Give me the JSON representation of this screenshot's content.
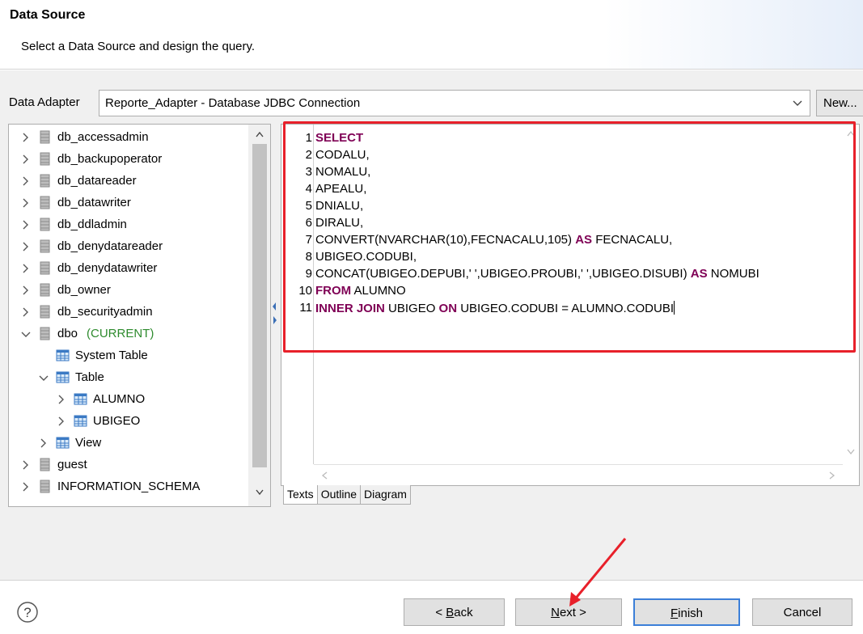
{
  "header": {
    "title": "Data Source",
    "subtitle": "Select a Data Source and design the query."
  },
  "adapter": {
    "label": "Data Adapter",
    "value": "Reporte_Adapter - Database JDBC Connection",
    "new_label": "New..."
  },
  "tree": {
    "items": [
      {
        "label": "db_accessadmin"
      },
      {
        "label": "db_backupoperator"
      },
      {
        "label": "db_datareader"
      },
      {
        "label": "db_datawriter"
      },
      {
        "label": "db_ddladmin"
      },
      {
        "label": "db_denydatareader"
      },
      {
        "label": "db_denydatawriter"
      },
      {
        "label": "db_owner"
      },
      {
        "label": "db_securityadmin"
      },
      {
        "label": "dbo",
        "current": "(CURRENT)"
      },
      {
        "label": "System Table"
      },
      {
        "label": "Table"
      },
      {
        "label": "ALUMNO"
      },
      {
        "label": "UBIGEO"
      },
      {
        "label": "View"
      },
      {
        "label": "guest"
      },
      {
        "label": "INFORMATION_SCHEMA"
      }
    ]
  },
  "editor": {
    "lines": [
      {
        "n": "1",
        "parts": [
          [
            "kw",
            "SELECT"
          ]
        ]
      },
      {
        "n": "2",
        "parts": [
          [
            "t",
            "CODALU,"
          ]
        ]
      },
      {
        "n": "3",
        "parts": [
          [
            "t",
            "NOMALU,"
          ]
        ]
      },
      {
        "n": "4",
        "parts": [
          [
            "t",
            "APEALU,"
          ]
        ]
      },
      {
        "n": "5",
        "parts": [
          [
            "t",
            "DNIALU,"
          ]
        ]
      },
      {
        "n": "6",
        "parts": [
          [
            "t",
            "DIRALU,"
          ]
        ]
      },
      {
        "n": "7",
        "parts": [
          [
            "t",
            "CONVERT(NVARCHAR(10),FECNACALU,105) "
          ],
          [
            "kw",
            "AS"
          ],
          [
            "t",
            " FECNACALU,"
          ]
        ]
      },
      {
        "n": "8",
        "parts": [
          [
            "t",
            "UBIGEO.CODUBI,"
          ]
        ]
      },
      {
        "n": "9",
        "parts": [
          [
            "t",
            "CONCAT(UBIGEO.DEPUBI,' ',UBIGEO.PROUBI,' ',UBIGEO.DISUBI) "
          ],
          [
            "kw",
            "AS"
          ],
          [
            "t",
            " NOMUBI"
          ]
        ]
      },
      {
        "n": "10",
        "parts": [
          [
            "kw",
            "FROM"
          ],
          [
            "t",
            " ALUMNO"
          ]
        ]
      },
      {
        "n": "11",
        "parts": [
          [
            "kw",
            "INNER JOIN"
          ],
          [
            "t",
            " UBIGEO "
          ],
          [
            "kw",
            "ON"
          ],
          [
            "t",
            " UBIGEO.CODUBI = ALUMNO.CODUBI"
          ]
        ]
      }
    ]
  },
  "tabs": [
    "Texts",
    "Outline",
    "Diagram"
  ],
  "buttons": {
    "back_prefix": "< ",
    "back_mn": "B",
    "back_rest": "ack",
    "next_mn": "N",
    "next_rest": "ext >",
    "finish_mn": "F",
    "finish_rest": "inish",
    "cancel": "Cancel"
  },
  "colors": {
    "keyword": "#7f0055",
    "current": "#2e8b2e",
    "highlight_box": "#e8202a",
    "annotation_arrow": "#e8202a"
  }
}
